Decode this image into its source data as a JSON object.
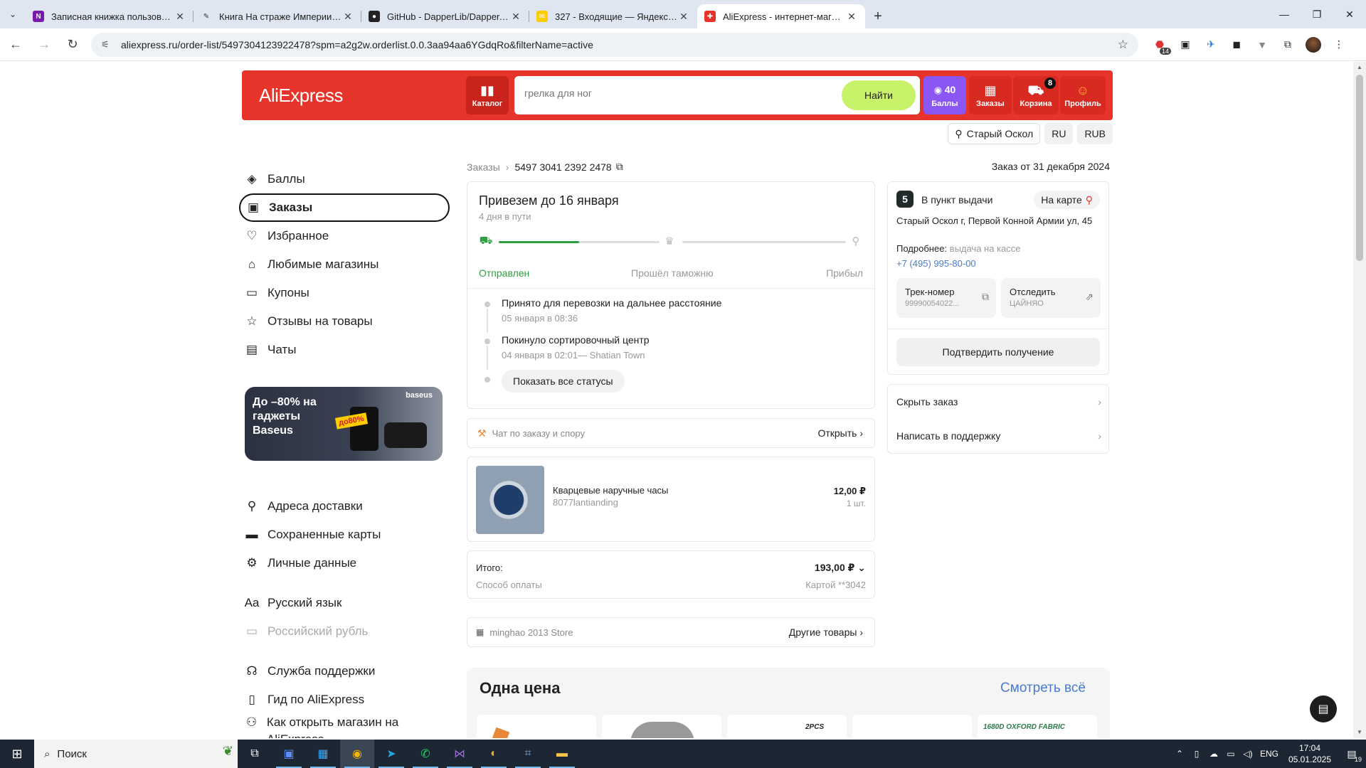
{
  "browser": {
    "tabs": [
      {
        "title": "Записная книжка пользовате",
        "icon": "onenote-icon",
        "color": "#7719aa",
        "glyph": "N",
        "active": false
      },
      {
        "title": "Книга На страже Империи. То",
        "icon": "book-icon",
        "color": "#dfe6f1",
        "glyph": "✎",
        "active": false
      },
      {
        "title": "GitHub - DapperLib/Dapper.Co",
        "icon": "github-icon",
        "color": "#222222",
        "glyph": "●",
        "active": false
      },
      {
        "title": "327 - Входящие — Яндекс Поч",
        "icon": "mail-icon",
        "color": "#ffcc00",
        "glyph": "✉",
        "active": false
      },
      {
        "title": "AliExpress - интернет-магазин",
        "icon": "aliexpress-icon",
        "color": "#e6342a",
        "glyph": "✚",
        "active": true
      }
    ],
    "url": "aliexpress.ru/order-list/5497304123922478?spm=a2g2w.orderlist.0.0.3aa94aa6YGdqRo&filterName=active",
    "ext_badge": "14"
  },
  "header": {
    "logo": "AliExpress",
    "catalog": "Каталог",
    "search_placeholder": "грелка для ног",
    "search_button": "Найти",
    "points_value": "40",
    "points_label": "Баллы",
    "orders_label": "Заказы",
    "cart_label": "Корзина",
    "cart_count": "8",
    "profile_label": "Профиль",
    "city": "Старый Оскол",
    "lang": "RU",
    "currency": "RUB"
  },
  "sidebar": {
    "top": [
      {
        "label": "Баллы",
        "icon": "points-icon",
        "glyph": "◈"
      },
      {
        "label": "Заказы",
        "icon": "box-icon",
        "glyph": "▣"
      },
      {
        "label": "Избранное",
        "icon": "heart-icon",
        "glyph": "♡"
      },
      {
        "label": "Любимые магазины",
        "icon": "store-icon",
        "glyph": "⌂"
      },
      {
        "label": "Купоны",
        "icon": "coupon-icon",
        "glyph": "▭"
      },
      {
        "label": "Отзывы на товары",
        "icon": "star-icon",
        "glyph": "☆"
      },
      {
        "label": "Чаты",
        "icon": "chat-icon",
        "glyph": "▤"
      }
    ],
    "banner": {
      "title": "До –80% на гаджеты Baseus",
      "brand": "baseus",
      "tag": "до80%"
    },
    "account": [
      {
        "label": "Адреса доставки",
        "icon": "location-pin-icon",
        "glyph": "⚲"
      },
      {
        "label": "Сохраненные карты",
        "icon": "card-icon",
        "glyph": "▬"
      },
      {
        "label": "Личные данные",
        "icon": "gear-icon",
        "glyph": "⚙"
      }
    ],
    "lang": [
      {
        "label": "Русский язык",
        "icon": "language-icon",
        "glyph": "Aa"
      },
      {
        "label": "Российский рубль",
        "icon": "currency-icon",
        "glyph": "▭"
      }
    ],
    "help": [
      {
        "label": "Служба поддержки",
        "icon": "headset-icon",
        "glyph": "☊"
      },
      {
        "label": "Гид по AliExpress",
        "icon": "guide-book-icon",
        "glyph": "▯"
      },
      {
        "label": "Как открыть магазин на AliExpress",
        "icon": "shop-open-icon",
        "glyph": "⚇"
      }
    ]
  },
  "order": {
    "breadcrumb_root": "Заказы",
    "order_number": "5497 3041 2392 2478",
    "order_date": "Заказ от 31 декабря 2024",
    "delivery_title": "Привезем до 16 января",
    "delivery_sub": "4 дня в пути",
    "progress": 0.5,
    "stages": [
      "Отправлен",
      "Прошёл таможню",
      "Прибыл"
    ],
    "events": [
      {
        "title": "Принято для перевозки на дальнее расстояние",
        "time": "05 января в 08:36"
      },
      {
        "title": "Покинуло сортировочный центр",
        "time": "04 января в 02:01— Shatian Town"
      }
    ],
    "show_all": "Показать все статусы",
    "chat_label": "Чат по заказу и спору",
    "chat_open": "Открыть",
    "item": {
      "name": "Кварцевые наручные часы",
      "sku": "8077lantianding",
      "price": "12,00 ₽",
      "qty": "1 шт."
    },
    "total_label": "Итого:",
    "total_value": "193,00 ₽",
    "payment_label": "Способ оплаты",
    "payment_value": "Картой **3042",
    "store_name": "minghao 2013 Store",
    "store_more": "Другие товары"
  },
  "pickup": {
    "number": "5",
    "title": "В пункт выдачи",
    "map": "На карте",
    "address": "Старый Оскол г, Первой Конной Армии ул, 45",
    "details_label": "Подробнее:",
    "details_value": "выдача на кассе",
    "phone": "+7 (495) 995-80-00",
    "track_label": "Трек-номер",
    "track_value": "99990054022...",
    "follow_label": "Отследить",
    "follow_value": "ЦАЙНЯО",
    "confirm": "Подтвердить получение",
    "hide": "Скрыть заказ",
    "support": "Написать в поддержку"
  },
  "reco": {
    "title": "Одна цена",
    "see_all": "Смотреть всё",
    "thumb_texts": [
      "",
      "",
      "2PCS",
      "",
      "1680D OXFORD FABRIC"
    ]
  },
  "taskbar": {
    "search": "Поиск",
    "lang": "ENG",
    "time": "17:04",
    "date": "05.01.2025",
    "notif_count": "19"
  }
}
